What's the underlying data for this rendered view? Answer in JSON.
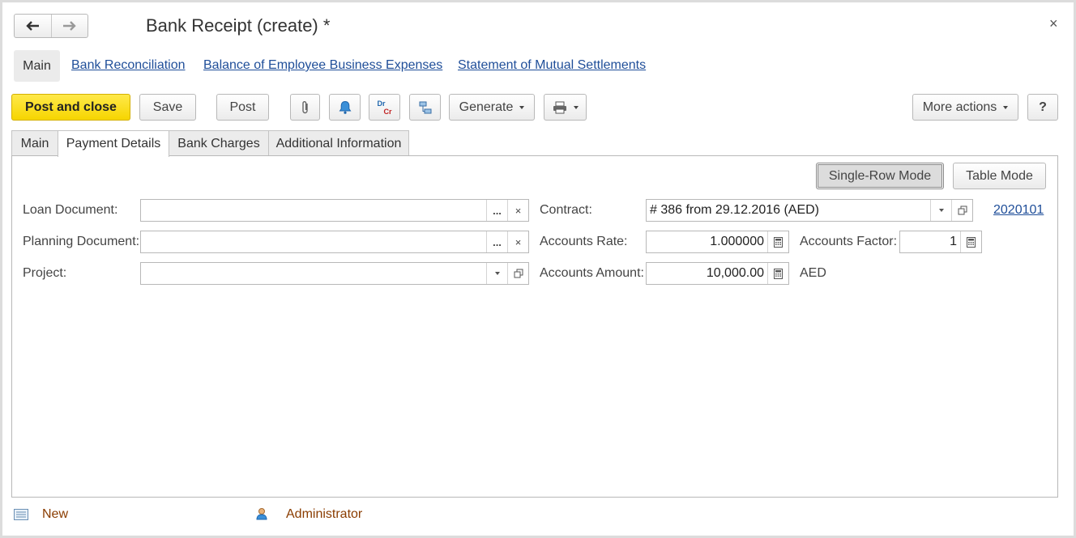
{
  "window": {
    "title": "Bank Receipt (create) *",
    "close_symbol": "×"
  },
  "nav_panel": {
    "main": "Main",
    "links": [
      "Bank Reconciliation",
      "Balance of Employee Business Expenses",
      "Statement of Mutual Settlements"
    ]
  },
  "toolbar": {
    "post_and_close": "Post and close",
    "save": "Save",
    "post": "Post",
    "dr": "Dr",
    "cr": "Cr",
    "generate": "Generate",
    "more_actions": "More actions",
    "help": "?"
  },
  "tabs": [
    "Main",
    "Payment Details",
    "Bank Charges",
    "Additional Information"
  ],
  "active_tab": "Payment Details",
  "mode_buttons": {
    "single_row": "Single-Row Mode",
    "table": "Table Mode"
  },
  "form": {
    "loan_document": {
      "label": "Loan Document:",
      "value": ""
    },
    "planning_document": {
      "label": "Planning Document:",
      "value": ""
    },
    "project": {
      "label": "Project:",
      "value": ""
    },
    "contract": {
      "label": "Contract:",
      "value": "# 386 from 29.12.2016 (AED)",
      "link": "2020101"
    },
    "accounts_rate": {
      "label": "Accounts Rate:",
      "value": "1.000000"
    },
    "accounts_factor": {
      "label": "Accounts Factor:",
      "value": "1"
    },
    "accounts_amount": {
      "label": "Accounts Amount:",
      "value": "10,000.00",
      "currency": "AED"
    },
    "dots": "...",
    "clear": "×"
  },
  "footer": {
    "status": "New",
    "user": "Administrator"
  },
  "colors": {
    "primary_button": "#f6d500",
    "link": "#1f4e99",
    "footer_text": "#8a3c00"
  }
}
